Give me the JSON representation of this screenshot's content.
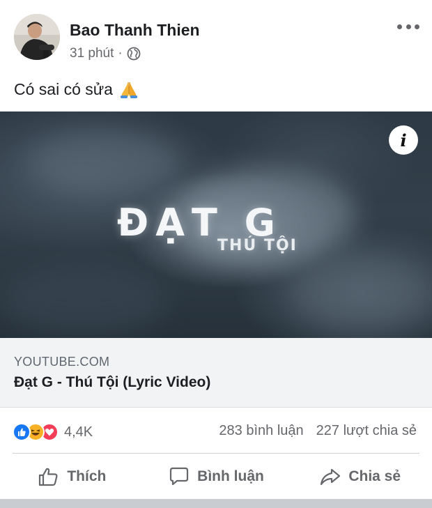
{
  "post": {
    "author": "Bao Thanh Thien",
    "time": "31 phút",
    "separator": "·",
    "privacy_icon": "globe-icon",
    "caption": "Có sai có sửa",
    "caption_emoji": "folded-hands-emoji"
  },
  "link_preview": {
    "thumbnail_title": "ĐẠT G",
    "thumbnail_subtitle": "THÚ TỘI",
    "info_label": "i",
    "domain": "YOUTUBE.COM",
    "title": "Đạt G - Thú Tội (Lyric Video)"
  },
  "stats": {
    "reactions": [
      "like",
      "haha",
      "love"
    ],
    "reaction_count": "4,4K",
    "comments": "283 bình luận",
    "shares": "227 lượt chia sẻ"
  },
  "actions": {
    "like": "Thích",
    "comment": "Bình luận",
    "share": "Chia sẻ"
  },
  "colors": {
    "like_blue": "#1877f2",
    "haha_yellow": "#f7b125",
    "love_red": "#f33e58",
    "secondary_text": "#65676b"
  }
}
